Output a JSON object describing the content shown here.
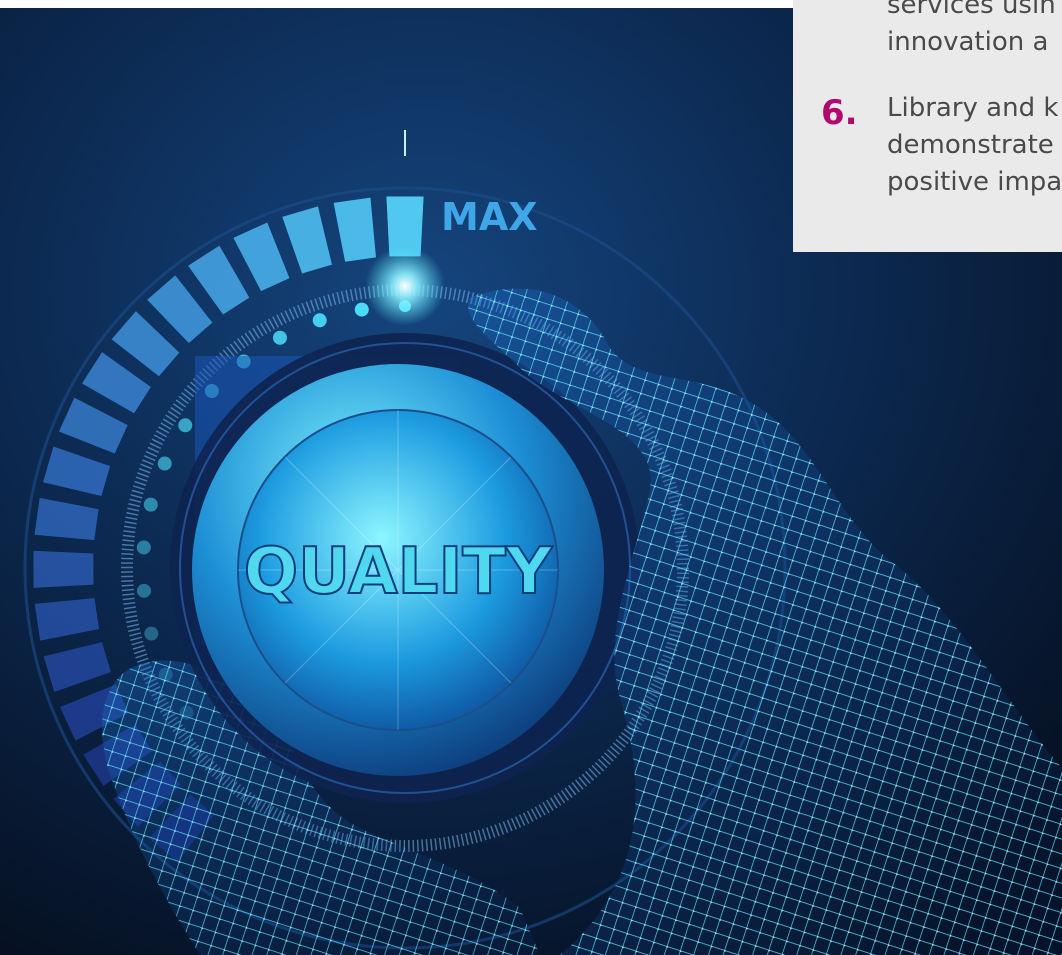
{
  "hero": {
    "max_label": "MAX",
    "knob_label": "QUALITY",
    "icon": "hand-turning-quality-knob-to-max"
  },
  "panel": {
    "item_5": {
      "lines": [
        "services usin",
        "innovation a"
      ]
    },
    "item_6": {
      "number": "6.",
      "lines": [
        "Library and k",
        "demonstrate",
        "positive impa"
      ]
    }
  },
  "colors": {
    "background": "#0a1a33",
    "glow": "#4ee6ff",
    "panel": "#eaeaea",
    "number_accent": "#b0086e"
  }
}
